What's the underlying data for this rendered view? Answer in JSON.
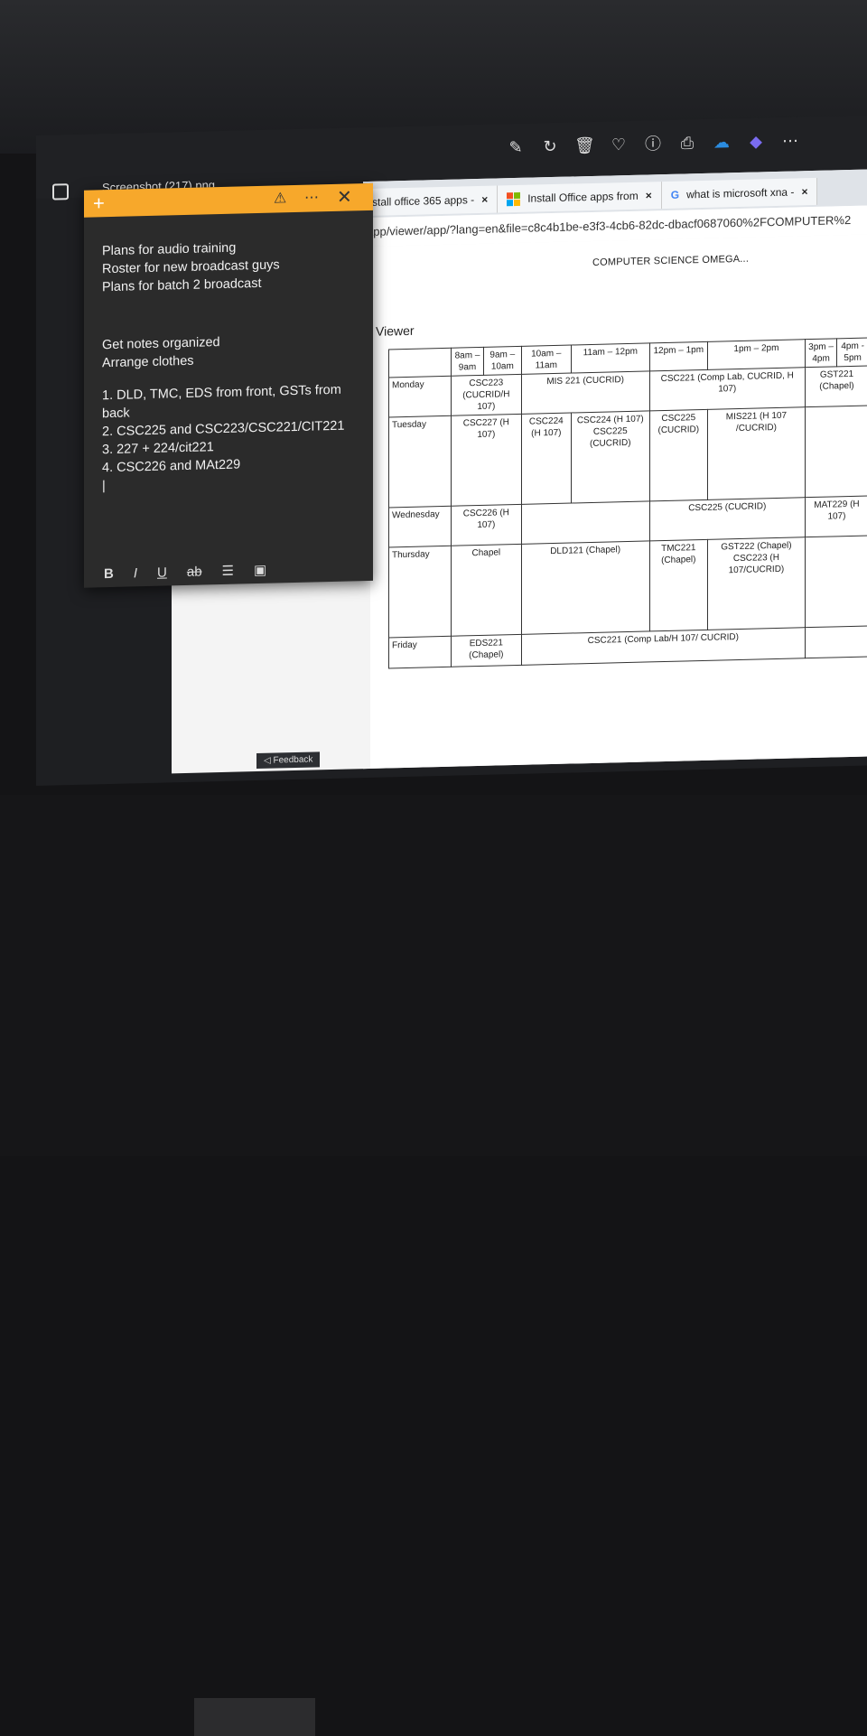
{
  "photo_viewer": {
    "file_name": "Screenshot (217).png",
    "toolbar_icons": [
      "edit-icon",
      "rotate-icon",
      "delete-icon",
      "favorite-icon",
      "info-icon",
      "print-icon",
      "onedrive-icon",
      "clipchamp-icon",
      "more-icon"
    ]
  },
  "sticky_note": {
    "lines_a": [
      "Plans for audio training",
      "Roster for new broadcast guys",
      "Plans for batch 2 broadcast"
    ],
    "lines_b": [
      "Get notes organized",
      "Arrange clothes"
    ],
    "list": [
      "1. DLD, TMC, EDS from front, GSTs from back",
      "2. CSC225 and CSC223/CSC221/CIT221",
      "3. 227 + 224/cit221",
      "4. CSC226 and MAt229"
    ],
    "format": {
      "bold": "B",
      "italic": "I",
      "underline": "U",
      "strike": "ab"
    }
  },
  "browser": {
    "tabs": [
      {
        "label": "stall office 365 apps - ",
        "close": "×"
      },
      {
        "label": "Install Office apps from ",
        "close": "×"
      },
      {
        "label": "what is microsoft xna - ",
        "close": "×"
      }
    ],
    "address": "app/viewer/app/?lang=en&file=c8c4b1be-e3f3-4cb6-82dc-dbacf0687060%2FCOMPUTER%2",
    "viewer_label": "Viewer",
    "doc_title": "COMPUTER SCIENCE OMEGA..."
  },
  "timetable": {
    "headers": [
      "",
      "8am – 9am",
      "9am – 10am",
      "10am – 11am",
      "11am – 12pm",
      "12pm – 1pm",
      "1pm – 2pm",
      "3pm – 4pm",
      "4pm - 5pm"
    ],
    "rows": [
      {
        "day": "Monday",
        "cells": [
          "CSC223 (CUCRID/H 107)",
          "MIS 221 (CUCRID)",
          "CSC221 (Comp Lab, CUCRID, H 107)",
          "GST221 (Chapel)"
        ]
      },
      {
        "day": "Tuesday",
        "cells": [
          "CSC227 (H 107)",
          "CSC224 (H 107)",
          "CSC224 (H 107) CSC225 (CUCRID)",
          "CSC225 (CUCRID)",
          "MIS221 (H 107 /CUCRID)"
        ]
      },
      {
        "day": "Wednesday",
        "cells": [
          "CSC226 (H 107)",
          "CSC225 (CUCRID)",
          "MAT229 (H 107)"
        ]
      },
      {
        "day": "Thursday",
        "cells": [
          "Chapel",
          "DLD121 (Chapel)",
          "TMC221 (Chapel)",
          "GST222 (Chapel) CSC223 (H 107/CUCRID)"
        ]
      },
      {
        "day": "Friday",
        "cells": [
          "EDS221 (Chapel)",
          "CSC221 (Comp Lab/H 107/ CUCRID)"
        ]
      }
    ]
  },
  "feedback_label": "Feedback"
}
